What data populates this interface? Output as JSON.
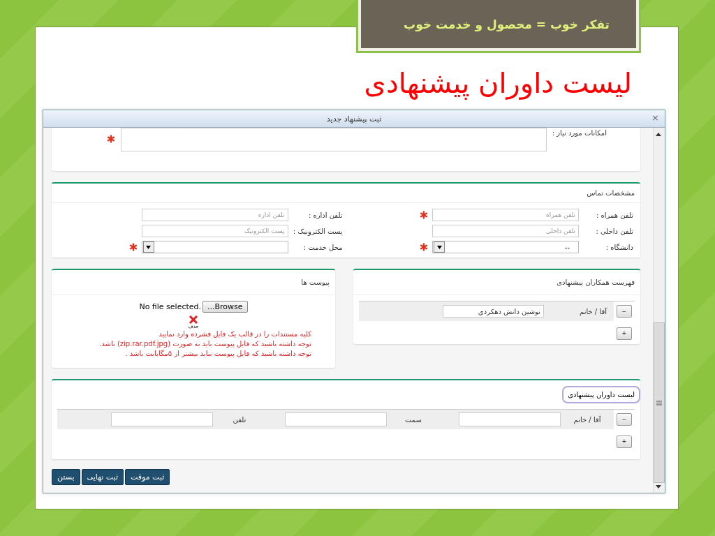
{
  "slide": {
    "banner": "تفکر خوب = محصول و خدمت خوب",
    "title": "لیست داوران پیشنهادی"
  },
  "dialog": {
    "title": "ثبت پیشنهاد جدید",
    "close": "×",
    "needs": {
      "label": "امکانات مورد نیاز :",
      "required": true
    },
    "contact": {
      "heading": "مشخصات تماس",
      "fields": [
        {
          "label": "تلفن همراه :",
          "kind": "text",
          "placeholder": "تلفن همراه",
          "required": true
        },
        {
          "label": "تلفن اداره :",
          "kind": "text",
          "placeholder": "تلفن اداره",
          "required": false
        },
        {
          "label": "تلفن داخلی :",
          "kind": "text",
          "placeholder": "تلفن داخلی",
          "required": false
        },
        {
          "label": "پست الکترونیک :",
          "kind": "text",
          "placeholder": "پست الکترونیک",
          "required": false
        },
        {
          "label": "دانشگاه :",
          "kind": "select",
          "value": "--",
          "required": true
        },
        {
          "label": "محل خدمت :",
          "kind": "select",
          "required": true
        }
      ]
    },
    "colleagues": {
      "heading": "فهرست همکاران پیشنهادی",
      "rows": [
        {
          "remove": "−",
          "title_label": "آقا / خانم",
          "name": "نوشین دانش دهکردي"
        }
      ],
      "add": "+"
    },
    "attachments": {
      "heading": "پیوست ها",
      "file_status": "No file selected.",
      "browse": "Browse...",
      "delete": "حذف",
      "notes": [
        "کلیه مستندات را در قالب یک فایل فشرده وارد نمایید",
        "توجه داشته باشید که فایل پیوست باید به صورت (zip.rar.pdf.jpg) باشد.",
        "توجه داشته باشید که فایل پیوست نباید بیشتر از ۵مگابایت باشد ."
      ]
    },
    "referees": {
      "heading": "لیست داوران پیشنهادی",
      "highlighted": true,
      "rows": [
        {
          "remove": "−",
          "labels": [
            "آقا / خانم",
            "سمت",
            "تلفن"
          ]
        }
      ],
      "add": "+"
    },
    "buttons": [
      "ثبت موقت",
      "ثبت نهایی",
      "بستن"
    ]
  }
}
